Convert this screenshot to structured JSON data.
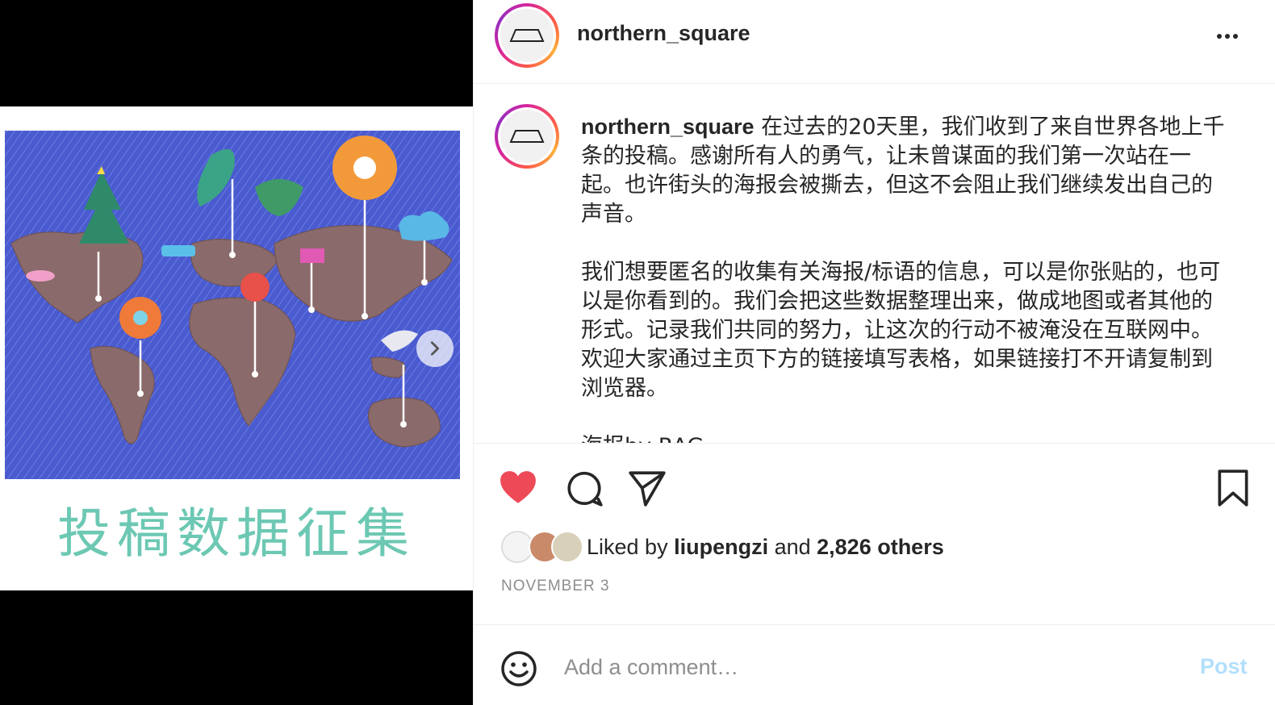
{
  "media": {
    "poster_caption": "投稿数据征集",
    "next_icon": "chevron-right-icon"
  },
  "header": {
    "username": "northern_square",
    "more_icon": "more-horizontal-icon"
  },
  "caption": {
    "username": "northern_square",
    "paragraph1": "在过去的20天里，我们收到了来自世界各地上千条的投稿。感谢所有人的勇气，让未曾谋面的我们第一次站在一起。也许街头的海报会被撕去，但这不会阻止我们继续发出自己的声音。",
    "paragraph2": "我们想要匿名的收集有关海报/标语的信息，可以是你张贴的，也可以是你看到的。我们会把这些数据整理出来，做成地图或者其他的形式。记录我们共同的努力，让这次的行动不被淹没在互联网中。欢迎大家通过主页下方的链接填写表格，如果链接打不开请复制到浏览器。",
    "paragraph3": "海报by RAG"
  },
  "actions": {
    "like_icon": "heart-filled-icon",
    "comment_icon": "comment-icon",
    "share_icon": "send-icon",
    "save_icon": "bookmark-icon",
    "like_color": "#ed4956"
  },
  "likes": {
    "prefix": "Liked by ",
    "user": "liupengzi",
    "middle": " and ",
    "others": "2,826 others"
  },
  "date": "NOVEMBER 3",
  "comment": {
    "emoji_icon": "smiley-icon",
    "placeholder": "Add a comment…",
    "post_label": "Post",
    "post_color": "#b2dffc"
  }
}
